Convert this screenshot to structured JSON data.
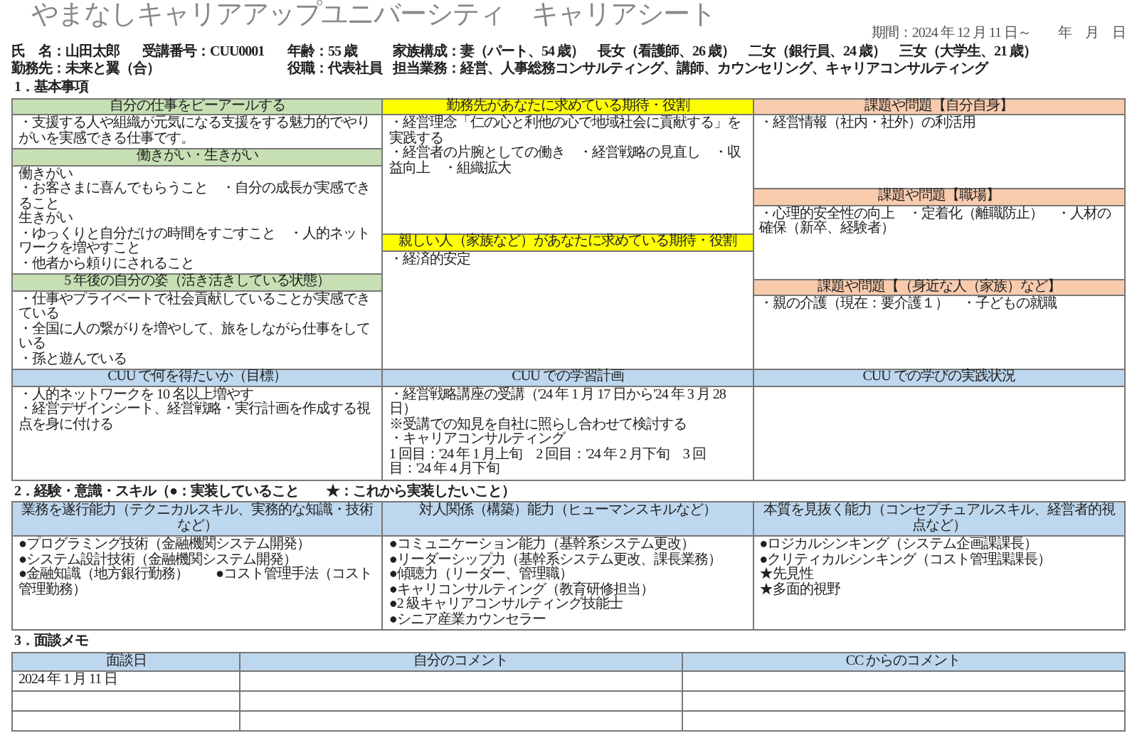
{
  "title": "やまなしキャリアアップユニバーシティ　キャリアシート",
  "period": "期間：2024 年 12 月 11 日～　　年　月　日",
  "profile": {
    "name": "氏　名：山田太郎",
    "student_no": "受講番号：CUU0001",
    "age": "年齢：55 歳",
    "family": "家族構成：妻（パート、54 歳）　長女（看護師、26 歳）　二女（銀行員、24 歳）　三女（大学生、21 歳）",
    "workplace": "勤務先：未来と翼（合）",
    "position": "役職：代表社員",
    "duties": "担当業務：経営、人事総務コンサルティング、講師、カウンセリング、キャリアコンサルティング"
  },
  "basic": {
    "heading": "1．基本事項",
    "columns": [
      {
        "color": "#c6e0b4",
        "blocks": [
          {
            "title": "自分の仕事をピーアールする",
            "lines": [
              "・支援する人や組織が元気になる支援をする魅力的でやりがいを実感できる仕事です。"
            ]
          },
          {
            "title": "働きがい・生きがい",
            "lines": [
              "働きがい",
              "・お客さまに喜んでもらうこと　・自分の成長が実感できること",
              "生きがい",
              "・ゆっくりと自分だけの時間をすごすこと　・人的ネットワークを増やすこと",
              "・他者から頼りにされること"
            ]
          },
          {
            "title": "5 年後の自分の姿（活き活きしている状態）",
            "lines": [
              "・仕事やプライベートで社会貢献していることが実感できている",
              "・全国に人の繋がりを増やして、旅をしながら仕事をしている",
              "・孫と遊んでいる"
            ]
          }
        ]
      },
      {
        "color": "#ffff00",
        "blocks": [
          {
            "title": "勤務先があなたに求めている期待・役割",
            "lines": [
              "・経営理念「仁の心と利他の心で地域社会に貢献する」を実践する",
              "・経営者の片腕としての働き　・経営戦略の見直し　・収益向上　・組織拡大"
            ]
          },
          {
            "title": "親しい人（家族など）があなたに求めている期待・役割",
            "lines": [
              "・経済的安定"
            ]
          }
        ]
      },
      {
        "color": "#f8cbad",
        "blocks": [
          {
            "title": "課題や問題【自分自身】",
            "lines": [
              "・経営情報（社内・社外）の利活用"
            ]
          },
          {
            "title": "課題や問題【職場】",
            "lines": [
              "・心理的安全性の向上　・定着化（離職防止）　・人材の確保（新卒、経験者）"
            ]
          },
          {
            "title": "課題や問題【（身近な人（家族）など】",
            "lines": [
              "・親の介護（現在：要介護１）　・子どもの就職"
            ]
          }
        ]
      }
    ],
    "bottom": [
      {
        "title": "CUU で何を得たいか（目標）",
        "lines": [
          "・人的ネットワークを 10 名以上増やす",
          "・経営デザインシート、経営戦略・実行計画を作成する視点を身に付ける"
        ]
      },
      {
        "title": "CUU での学習計画",
        "lines": [
          "・経営戦略講座の受講（'24 年 1 月 17 日から'24 年 3 月 28 日）",
          "※受講での知見を自社に照らし合わせて検討する",
          "・キャリアコンサルティング",
          "1 回目：'24 年 1 月上旬　2 回目：'24 年 2 月下旬　3 回目：'24 年 4 月下旬"
        ]
      },
      {
        "title": "CUU での学びの実践状況"
      }
    ]
  },
  "skills": {
    "heading": "2．経験・意識・スキル（●：実装していること　　★：これから実装したいこと）",
    "columns": [
      {
        "title": "業務を遂行能力（テクニカルスキル、実務的な知識・技術など）",
        "items": [
          "●プログラミング技術（金融機関システム開発）",
          "●システム設計技術（金融機関システム開発）",
          "●金融知識（地方銀行勤務）　　●コスト管理手法（コスト管理勤務）"
        ]
      },
      {
        "title": "対人関係（構築）能力（ヒューマンスキルなど）",
        "items": [
          "●コミュニケーション能力（基幹系システム更改）",
          "●リーダーシップ力（基幹系システム更改、課長業務）",
          "●傾聴力（リーダー、管理職）",
          "●キャリコンサルティング（教育研修担当）",
          "●2 級キャリアコンサルティング技能士",
          "●シニア産業カウンセラー"
        ]
      },
      {
        "title": "本質を見抜く能力（コンセプチュアルスキル、経営者的視点など）",
        "items": [
          "●ロジカルシンキング（システム企画課課長）",
          "●クリティカルシンキング（コスト管理課課長）",
          "★先見性",
          "★多面的視野"
        ]
      }
    ]
  },
  "memo": {
    "heading": "3．面談メモ",
    "columns": [
      "面談日",
      "自分のコメント",
      "CC からのコメント"
    ],
    "rows": [
      {
        "date": "2024 年 1 月 11 日"
      },
      {},
      {}
    ]
  }
}
